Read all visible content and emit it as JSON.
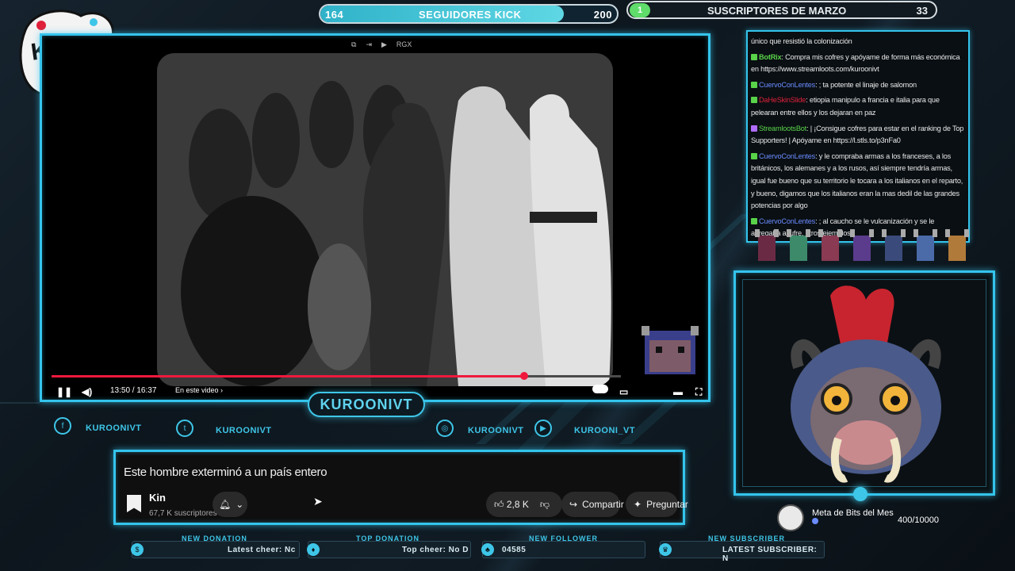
{
  "kick_goal": {
    "current": "164",
    "label": "SEGUIDORES KICK",
    "target": "200",
    "progress": 0.82
  },
  "sub_goal": {
    "count": "1",
    "label": "SUSCRIPTORES DE MARZO",
    "target": "33"
  },
  "video": {
    "top_controls": [
      "⧉",
      "⇥",
      "▶",
      "RGX"
    ],
    "time": "13:50 / 16:37",
    "chapter": "En este video",
    "progress": 0.83,
    "play_icon": "pause-icon",
    "volume_icon": "volume-icon"
  },
  "name_plate": "KUROONIVT",
  "socials": [
    {
      "icon": "facebook-icon",
      "glyph": "f",
      "label": "KUROONIVT"
    },
    {
      "icon": "twitter-icon",
      "glyph": "t",
      "label": "KUROONIVT"
    },
    {
      "icon": "instagram-icon",
      "glyph": "◎",
      "label": "KUROONIVT"
    },
    {
      "icon": "youtube-icon",
      "glyph": "▶",
      "label": "KUROONI_VT"
    }
  ],
  "youtube": {
    "title": "Este hombre exterminó a un país entero",
    "channel": "Kin",
    "subs": "67,7 K suscriptores",
    "likes": "2,8 K",
    "share": "Compartir",
    "ask": "Preguntar"
  },
  "chat": [
    {
      "user": "",
      "color": "#e9e9e9",
      "text": "único que resistió la colonización"
    },
    {
      "user": "BotRix",
      "color": "#59d34a",
      "text": ": Compra mis cofres y apóyame de forma más económica en https://www.streamloots.com/kuroonivt"
    },
    {
      "user": "CuervoConLentes",
      "color": "#6a8cff",
      "text": ": ; ta potente el linaje de salomon"
    },
    {
      "user": "DaHeSkinSlide",
      "color": "#e0203a",
      "text": ": etiopia manipulo a francia e italia para que pelearan entre ellos y los dejaran en paz"
    },
    {
      "user": "StreamlootsBot",
      "color": "#59d34a",
      "text": ": | ¡Consigue cofres para estar en el ranking de Top Supporters! | Apóyame en https://l.stls.to/p3nFa0"
    },
    {
      "user": "CuervoConLentes",
      "color": "#6a8cff",
      "text": ": y le compraba armas a los franceses, a los británicos, los alemanes y a los rusos, así siempre tendría armas, igual fue bueno que su territorio le tocara a los italianos en el reparto, y bueno, digamos que los italianos eran la mas dedil de las grandes potencias por algo"
    },
    {
      "user": "CuervoConLentes",
      "color": "#6a8cff",
      "text": ": ; al caucho se le vulcanización y se le agregaba azufre, otros ejemplos"
    }
  ],
  "bits_goal": {
    "label": "Meta de Bits del Mes",
    "value": "400/10000"
  },
  "bottom_widgets": [
    {
      "label": "NEW DONATION",
      "value": "Latest cheer: Nc",
      "icon": "$"
    },
    {
      "label": "TOP DONATION",
      "value": "Top cheer: No D",
      "icon": "♦"
    },
    {
      "label": "NEW FOLLOWER",
      "value": "04585",
      "icon": "♣"
    },
    {
      "label": "NEW SUBSCRIBER",
      "value": "LATEST SUBSCRIBER: N",
      "icon": "♛"
    }
  ],
  "colors": {
    "accent": "#34c4ec",
    "kick_green": "#5fdc6a",
    "yt_red": "#f0183d"
  }
}
